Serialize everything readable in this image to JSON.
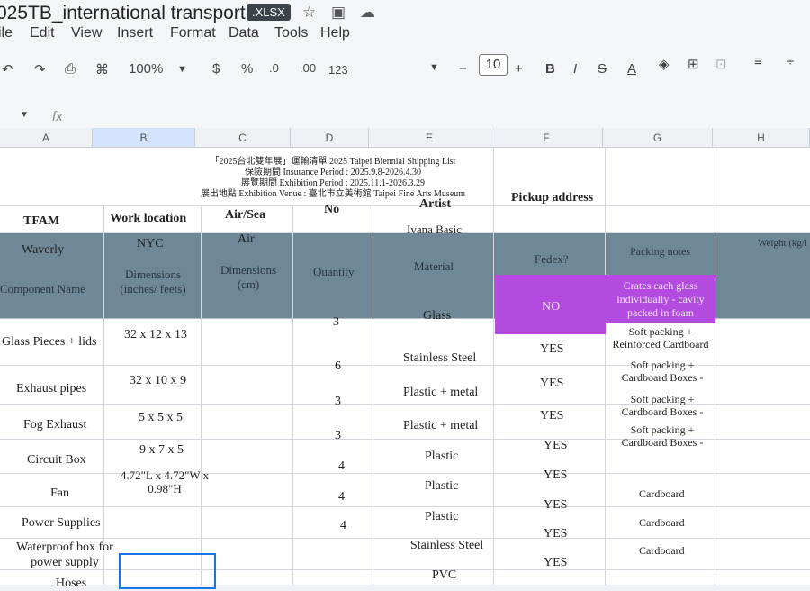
{
  "app": {
    "title": "025TB_international transport",
    "badge": ".XLSX"
  },
  "menu": {
    "file": "ile",
    "edit": "Edit",
    "view": "View",
    "insert": "Insert",
    "format": "Format",
    "data": "Data",
    "tools": "Tools",
    "help": "Help"
  },
  "toolbar": {
    "zoom": "100%",
    "currency": "$",
    "percent": "%",
    "dec_less": ".0",
    "dec_more": ".00",
    "num_format": "123",
    "font_size": "10",
    "bold": "B",
    "italic": "I"
  },
  "formula": {
    "fx": "fx"
  },
  "columns": [
    "A",
    "B",
    "C",
    "D",
    "E",
    "F",
    "G",
    "H"
  ],
  "info": {
    "line1": "「2025台北雙年展」運輸清單 2025 Taipei Biennial Shipping List",
    "line2": "保險期間 Insurance Period : 2025.9.8-2026.4.30",
    "line3": "展覽期間 Exhibition Period : 2025.11.1-2026.3.29",
    "line4": "展出地點 Exhibition Venue : 臺北市立美術館 Taipei Fine Arts Museum"
  },
  "hdr1": {
    "tfam": "TFAM",
    "work_location": "Work location",
    "air_sea": "Air/Sea",
    "no": "No",
    "artist": "Artist",
    "pickup": "Pickup address"
  },
  "hdr2": {
    "tfam": "Waverly",
    "work_location": "NYC",
    "air_sea": "Air",
    "artist": "Ivana Basic"
  },
  "band": {
    "component": "Component Name",
    "dim_in": "Dimensions (inches/ feets)",
    "dim_cm": "Dimensions (cm)",
    "quantity": "Quantity",
    "material": "Material",
    "fedex": "Fedex?",
    "packing": "Packing notes",
    "weight": "Weight (kg/l"
  },
  "rows": [
    {
      "name": "Glass Pieces + lids",
      "dim": "32 x 12 x 13",
      "qty": "3",
      "material": "Glass",
      "fedex": "NO",
      "notes": "Crates each glass individually - cavity packed in foam"
    },
    {
      "name": "Exhaust pipes",
      "dim": "32 x 10 x 9",
      "qty": "6",
      "material": "Stainless Steel",
      "fedex": "YES",
      "notes": "Soft packing + Reinforced Cardboard"
    },
    {
      "name": "Fog Exhaust",
      "dim": "5 x 5 x 5",
      "qty": "3",
      "material": "Plastic + metal",
      "fedex": "YES",
      "notes": "Soft packing + Cardboard Boxes -"
    },
    {
      "name": "Circuit Box",
      "dim": "9 x 7 x 5",
      "qty": "3",
      "material": "Plastic + metal",
      "fedex": "YES",
      "notes": "Soft packing + Cardboard Boxes -"
    },
    {
      "name": "Fan",
      "dim": "4.72\"L x 4.72\"W x 0.98\"H",
      "qty": "4",
      "material": "Plastic",
      "fedex": "YES",
      "notes": "Soft packing + Cardboard Boxes -"
    },
    {
      "name": "Power Supplies",
      "dim": "",
      "qty": "4",
      "material": "Plastic",
      "fedex": "YES",
      "notes": "Cardboard"
    },
    {
      "name": "Waterproof box for power supply",
      "dim": "",
      "qty": "4",
      "material": "Plastic",
      "fedex": "YES",
      "notes": "Cardboard"
    },
    {
      "name": "",
      "dim": "",
      "qty": "",
      "material": "Stainless Steel",
      "fedex": "YES",
      "notes": "Cardboard"
    },
    {
      "name": "Hoses",
      "dim": "",
      "qty": "",
      "material": "PVC",
      "fedex": "YES",
      "notes": ""
    }
  ],
  "colors": {
    "band": "#6f8898",
    "highlight": "#b44be0",
    "selection": "#1a73e8"
  }
}
